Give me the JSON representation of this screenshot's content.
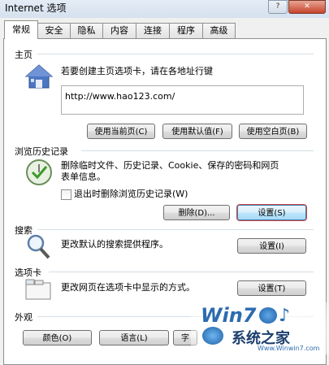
{
  "window": {
    "title": "Internet 选项",
    "help_label": "?",
    "close_label": "✕"
  },
  "tabs": [
    "常规",
    "安全",
    "隐私",
    "内容",
    "连接",
    "程序",
    "高级"
  ],
  "home": {
    "heading": "主页",
    "description": "若要创建主页选项卡，请在各地址行键",
    "url": "http://www.hao123.com/",
    "btn_current": "使用当前页(C)",
    "btn_default": "使用默认值(F)",
    "btn_blank": "使用空白页(B)"
  },
  "history": {
    "heading": "浏览历史记录",
    "description_1": "删除临时文件、历史记录、Cookie、保存的密码和网页",
    "description_2": "表单信息。",
    "checkbox_label": "退出时删除浏览历史记录(W)",
    "btn_delete": "删除(D)...",
    "btn_settings": "设置(S)"
  },
  "search": {
    "heading": "搜索",
    "description": "更改默认的搜索提供程序。",
    "btn_settings": "设置(I)"
  },
  "tabsection": {
    "heading": "选项卡",
    "description": "更改网页在选项卡中显示的方式。",
    "btn_settings": "设置(T)"
  },
  "appearance": {
    "heading": "外观",
    "btn_colors": "颜色(O)",
    "btn_languages": "语言(L)",
    "btn_fonts": "字"
  },
  "watermark": {
    "logo": "Win7",
    "site": "系统之家",
    "url": "Www.Winwin7.com"
  }
}
